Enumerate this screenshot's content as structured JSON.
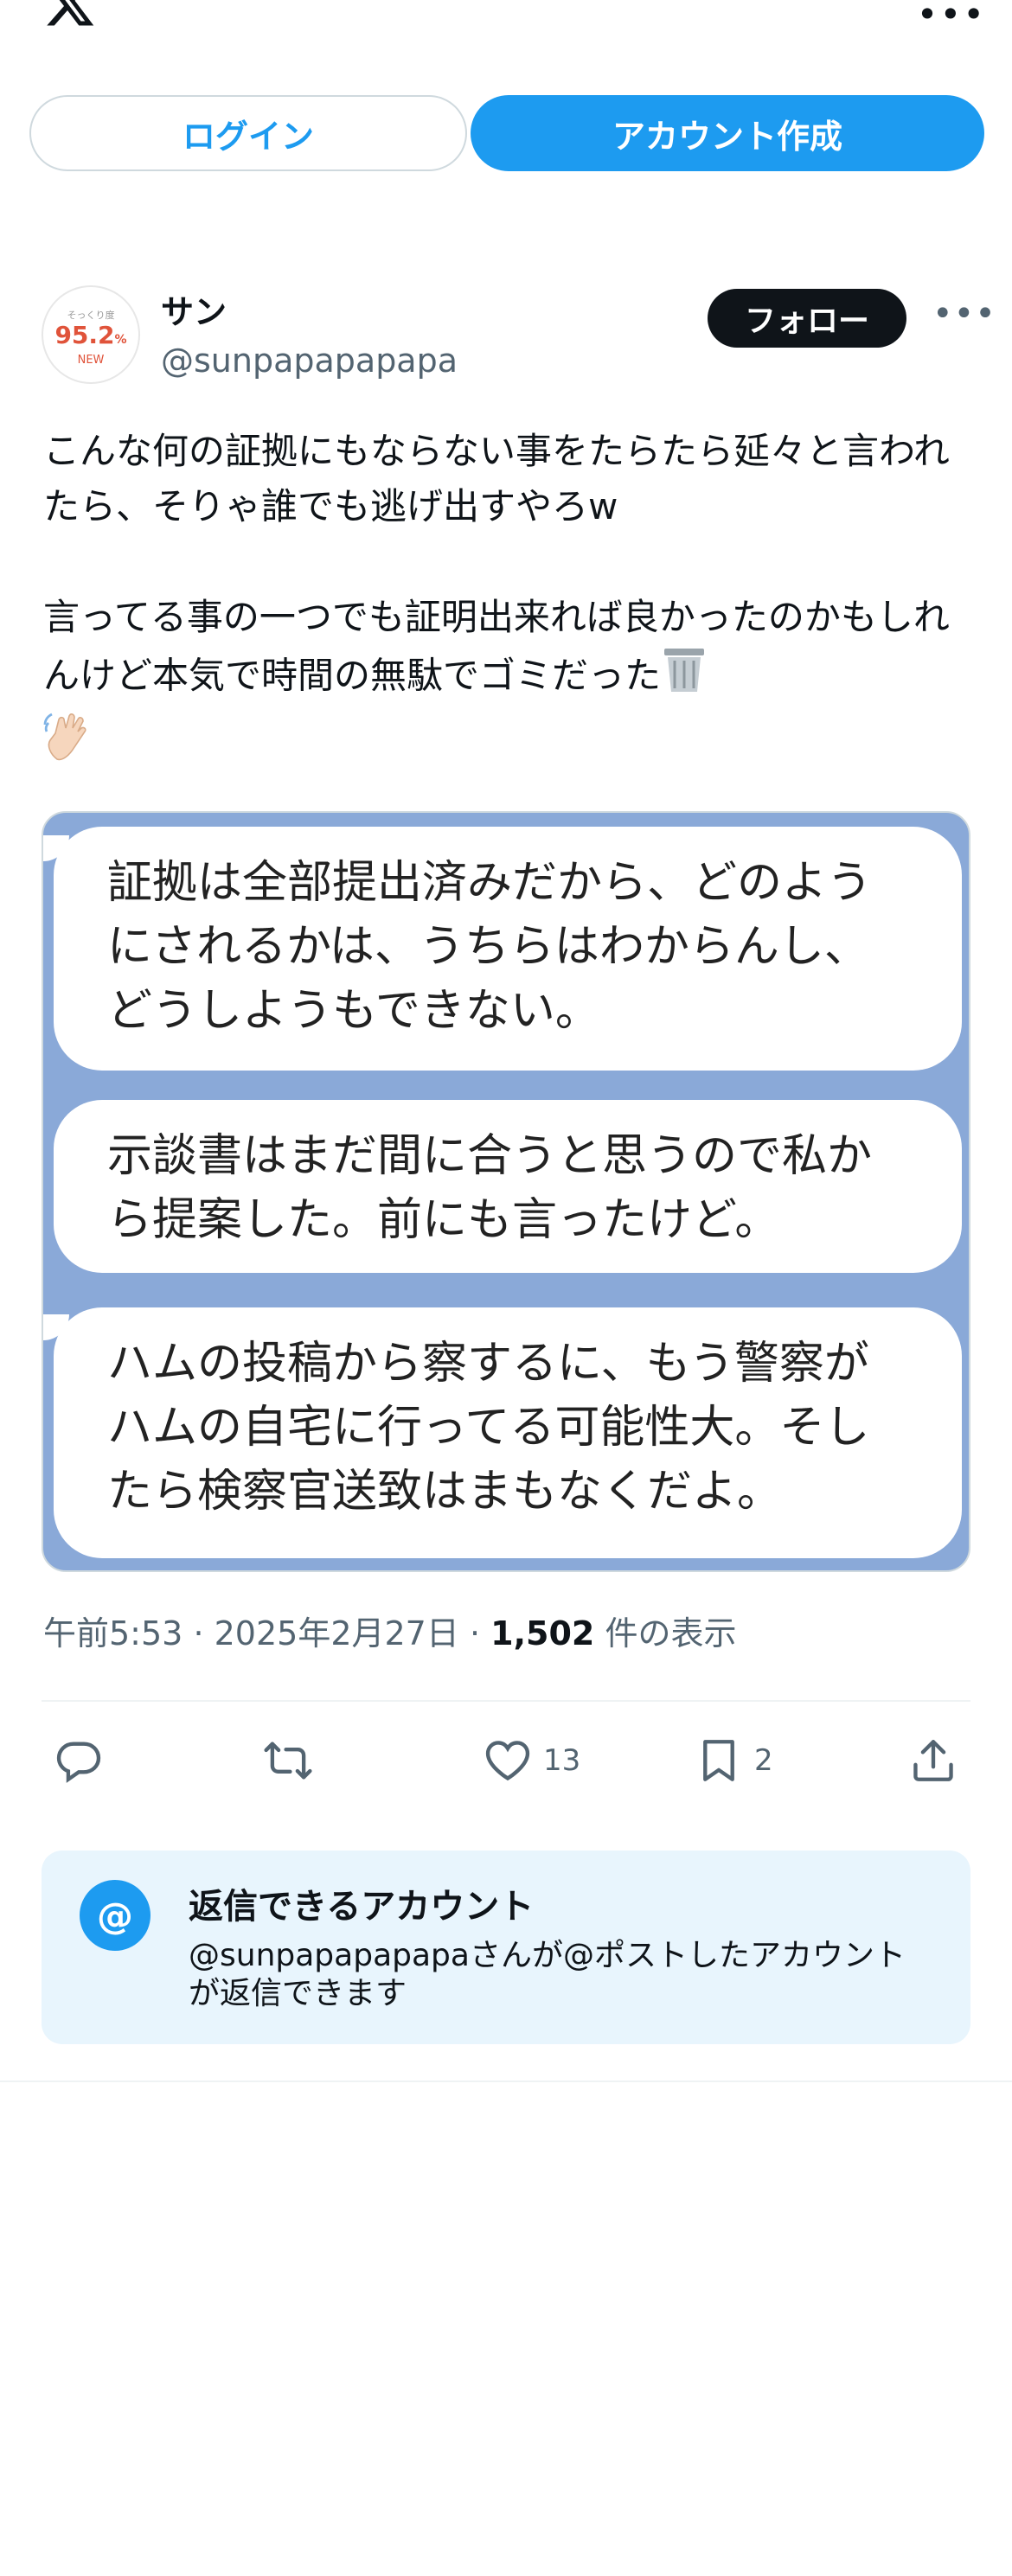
{
  "header": {
    "logo_icon": "x-logo-icon",
    "more_icon": "more-horizontal-icon",
    "login_label": "ログイン",
    "signup_label": "アカウント作成"
  },
  "post": {
    "author": {
      "name": "サン",
      "handle": "@sunpapapapapa",
      "avatar_text": {
        "line1": "そっくり度",
        "line2": "95.2",
        "line2_unit": "%",
        "line3": "NEW"
      }
    },
    "follow_label": "フォロー",
    "text_para1": "こんな何の証拠にもならない事をたらたら延々と言われたら、そりゃ誰でも逃げ出すやろw",
    "text_para2": "言ってる事の一つでも証明出来れば良かったのかもしれんけど本気で時間の無駄でゴミだった",
    "emojis": [
      "wastebasket-icon",
      "waving-hand-icon"
    ],
    "image_bubbles": [
      "証拠は全部提出済みだから、どのようにされるかは、うちらはわからんし、どうしようもできない。",
      "示談書はまだ間に合うと思うので私から提案した。前にも言ったけど。",
      "ハムの投稿から察するに、もう警察がハムの自宅に行ってる可能性大。そしたら検察官送致はまもなくだよ。"
    ],
    "time": "午前5:53",
    "date": "2025年2月27日",
    "views_count": "1,502",
    "views_label": "件の表示",
    "separator": "·",
    "actions": {
      "reply_icon": "reply-icon",
      "repost_icon": "repost-icon",
      "like_icon": "heart-icon",
      "like_count": "13",
      "bookmark_icon": "bookmark-icon",
      "bookmark_count": "2",
      "share_icon": "share-icon"
    }
  },
  "reply_settings": {
    "icon": "at-icon",
    "icon_text": "@",
    "title": "返信できるアカウント",
    "description": "@sunpapapapapaさんが@ポストしたアカウントが返信できます"
  },
  "colors": {
    "accent": "#1d9bf0",
    "text": "#0f1419",
    "secondary": "#536471",
    "image_bg": "#8aa9d8"
  }
}
